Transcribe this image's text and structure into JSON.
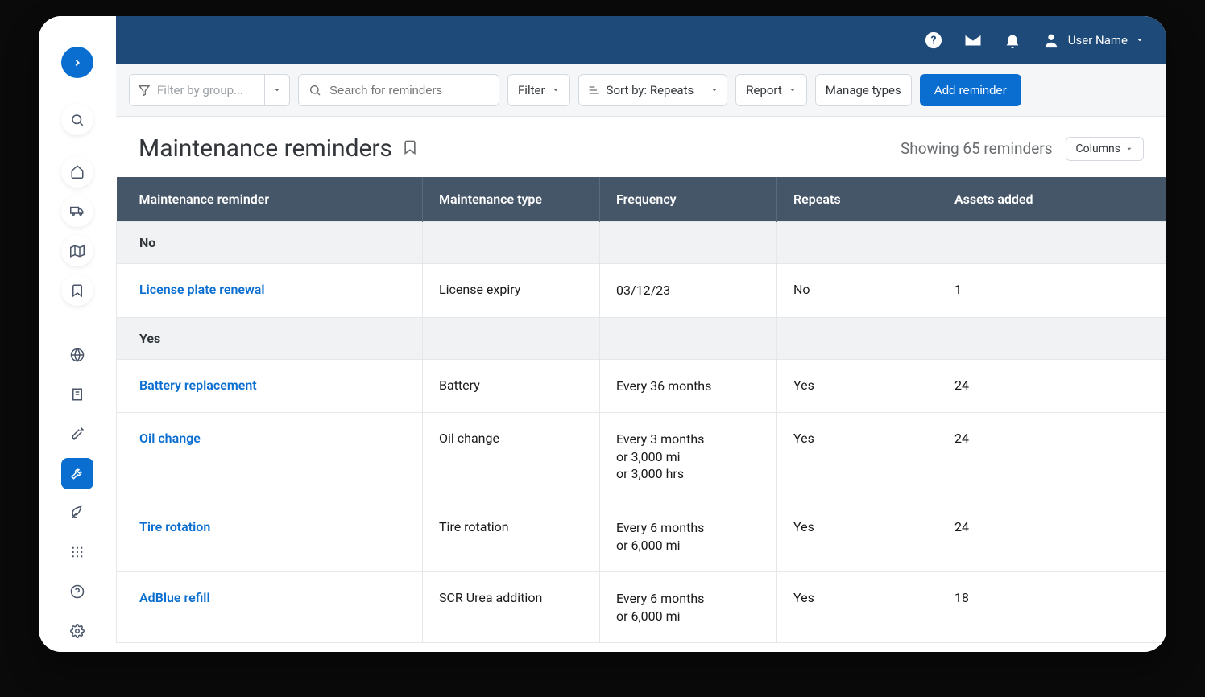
{
  "user": {
    "label": "User Name"
  },
  "filterbar": {
    "group_placeholder": "Filter by group...",
    "search_placeholder": "Search for reminders",
    "filter_label": "Filter",
    "sort_label": "Sort by: Repeats",
    "report_label": "Report",
    "manage_types_label": "Manage types",
    "add_reminder_label": "Add reminder"
  },
  "header": {
    "title": "Maintenance reminders",
    "showing": "Showing 65 reminders",
    "columns_label": "Columns"
  },
  "table": {
    "columns": {
      "reminder": "Maintenance reminder",
      "type": "Maintenance type",
      "frequency": "Frequency",
      "repeats": "Repeats",
      "assets": "Assets added"
    },
    "groups": [
      {
        "label": "No",
        "rows": [
          {
            "reminder": "License plate renewal",
            "type": "License expiry",
            "frequency": [
              "03/12/23"
            ],
            "repeats": "No",
            "assets": "1"
          }
        ]
      },
      {
        "label": "Yes",
        "rows": [
          {
            "reminder": "Battery replacement",
            "type": "Battery",
            "frequency": [
              "Every 36 months"
            ],
            "repeats": "Yes",
            "assets": "24"
          },
          {
            "reminder": "Oil change",
            "type": "Oil change",
            "frequency": [
              "Every 3 months",
              "or 3,000 mi",
              "or 3,000 hrs"
            ],
            "repeats": "Yes",
            "assets": "24"
          },
          {
            "reminder": "Tire rotation",
            "type": "Tire rotation",
            "frequency": [
              "Every 6 months",
              "or 6,000 mi"
            ],
            "repeats": "Yes",
            "assets": "24"
          },
          {
            "reminder": "AdBlue refill",
            "type": "SCR Urea addition",
            "frequency": [
              "Every 6 months",
              "or 6,000 mi"
            ],
            "repeats": "Yes",
            "assets": "18"
          }
        ]
      }
    ]
  }
}
